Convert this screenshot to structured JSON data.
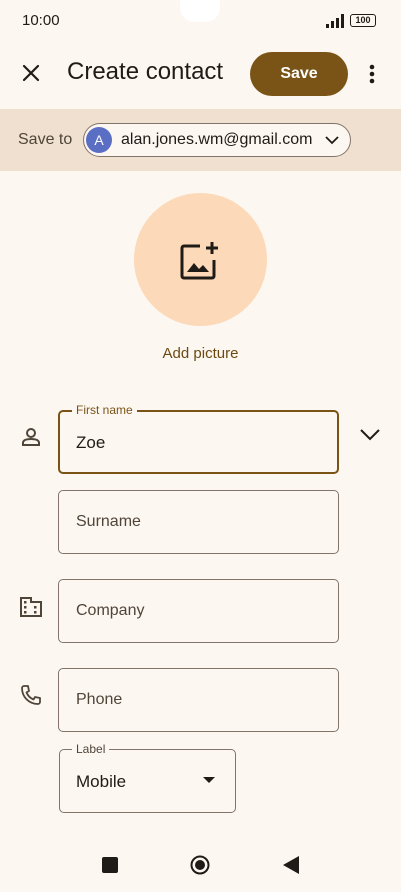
{
  "status_bar": {
    "time": "10:00",
    "battery": "100"
  },
  "header": {
    "title": "Create contact",
    "save_label": "Save"
  },
  "save_to": {
    "label": "Save to",
    "avatar_letter": "A",
    "account": "alan.jones.wm@gmail.com"
  },
  "picture": {
    "label": "Add picture"
  },
  "fields": {
    "first_name": {
      "label": "First name",
      "value": "Zoe"
    },
    "surname": {
      "placeholder": "Surname"
    },
    "company": {
      "placeholder": "Company"
    },
    "phone": {
      "placeholder": "Phone"
    },
    "phone_label": {
      "label": "Label",
      "value": "Mobile"
    }
  },
  "icons": [
    "close-icon",
    "more-vert-icon",
    "chevron-down-icon",
    "add-photo-icon",
    "person-icon",
    "business-icon",
    "phone-icon",
    "dropdown-arrow-icon"
  ],
  "colors": {
    "accent": "#7a5416",
    "background": "#fdf7f2",
    "strip": "#f0e0d0",
    "avatar_circle": "#fcd9b8",
    "account_avatar": "#5a6fc4"
  }
}
